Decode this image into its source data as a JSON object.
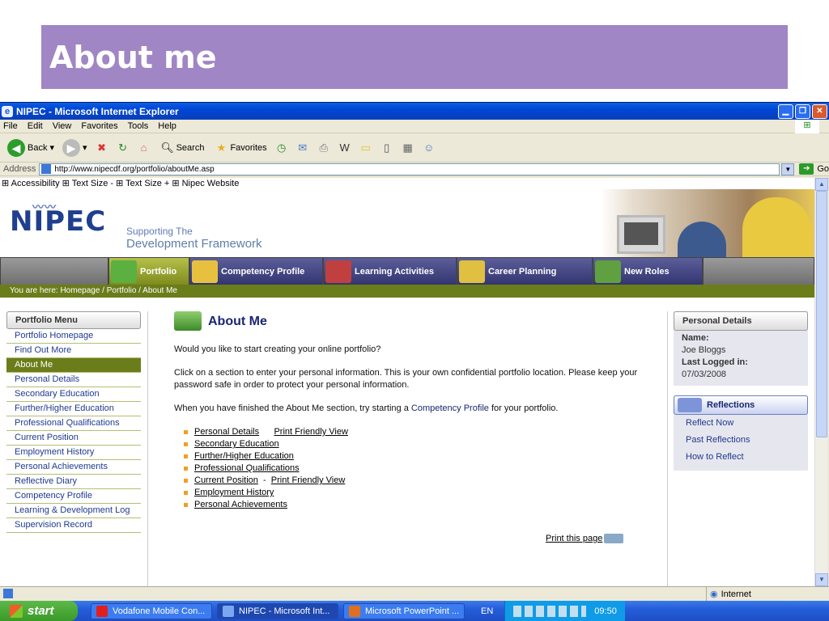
{
  "slide": {
    "title": "About me"
  },
  "window": {
    "title": "NIPEC - Microsoft Internet Explorer",
    "menu": [
      "File",
      "Edit",
      "View",
      "Favorites",
      "Tools",
      "Help"
    ],
    "toolbar": {
      "back": "Back",
      "search": "Search",
      "favorites": "Favorites"
    },
    "address": {
      "label": "Address",
      "url": "http://www.nipecdf.org/portfolio/aboutMe.asp",
      "go": "Go"
    },
    "status": {
      "zone": "Internet"
    }
  },
  "page": {
    "top_links": "⊞ Accessibility ⊞ Text Size - ⊞ Text Size + ⊞ Nipec Website",
    "logo": "NIPEC",
    "tagline_1": "Supporting The",
    "tagline_2": "Development Framework",
    "tabs": [
      "Portfolio",
      "Competency Profile",
      "Learning Activities",
      "Career Planning",
      "New Roles"
    ],
    "breadcrumb": "You are here: Homepage / Portfolio / About Me",
    "portfolio_menu": {
      "title": "Portfolio Menu",
      "items": [
        "Portfolio Homepage",
        "Find Out More",
        "About Me",
        "Personal Details",
        "Secondary Education",
        "Further/Higher Education",
        "Professional Qualifications",
        "Current Position",
        "Employment History",
        "Personal Achievements",
        "Reflective Diary",
        "Competency Profile",
        "Learning & Development Log",
        "Supervision Record"
      ],
      "active": "About Me"
    },
    "content": {
      "title": "About Me",
      "p1": "Would you like to start creating your online portfolio?",
      "p2": "Click on a section to enter your personal information. This is your own confidential portfolio location. Please keep your password safe in order to protect your personal information.",
      "p3_pre": "When you have finished the About Me section, try starting a ",
      "p3_link": "Competency Profile",
      "p3_post": " for your portfolio.",
      "links": [
        "Personal Details",
        "Secondary Education",
        "Further/Higher Education",
        "Professional Qualifications",
        "Current Position",
        "Employment History",
        "Personal Achievements"
      ],
      "print_friendly": "Print Friendly View",
      "dash": "-",
      "print_page": "Print this page"
    },
    "personal_details": {
      "title": "Personal Details",
      "name_label": "Name:",
      "name": "Joe Bloggs",
      "last_label": "Last Logged in:",
      "last": "07/03/2008"
    },
    "reflections": {
      "title": "Reflections",
      "items": [
        "Reflect Now",
        "Past Reflections",
        "How to Reflect"
      ]
    }
  },
  "taskbar": {
    "start": "start",
    "tasks": [
      "Vodafone Mobile Con...",
      "NIPEC - Microsoft Int...",
      "Microsoft PowerPoint ..."
    ],
    "lang": "EN",
    "time": "09:50"
  }
}
